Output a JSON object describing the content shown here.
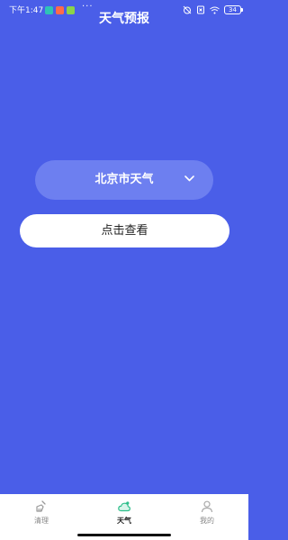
{
  "status_bar": {
    "time": "下午1:47",
    "more": "···",
    "battery": "34",
    "notif_colors": [
      "#2ec4b6",
      "#ff6b4a",
      "#8bd34a"
    ]
  },
  "header": {
    "title": "天气预报"
  },
  "city_selector": {
    "label": "北京市天气"
  },
  "action": {
    "check_label": "点击查看"
  },
  "bottom_nav": {
    "items": [
      {
        "label": "清理",
        "icon": "broom-icon"
      },
      {
        "label": "天气",
        "icon": "cloud-icon",
        "active": true
      },
      {
        "label": "我的",
        "icon": "person-icon"
      }
    ]
  },
  "colors": {
    "background": "#4a5ee8",
    "accent": "#2dbe8a"
  }
}
